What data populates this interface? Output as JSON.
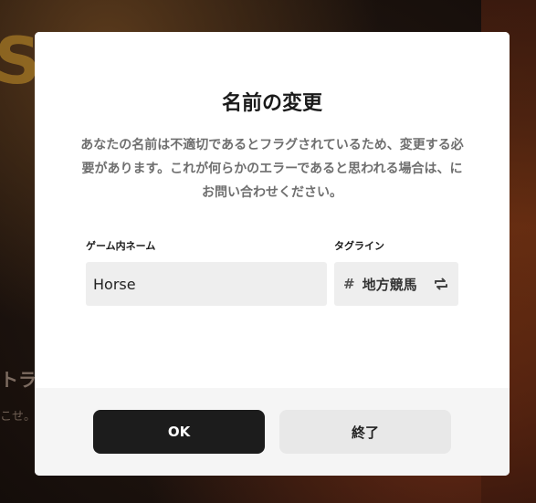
{
  "background": {
    "logo_fragment": "S",
    "text_fragment_1": "トラ",
    "text_fragment_2": "こせ。"
  },
  "dialog": {
    "title": "名前の変更",
    "message": "あなたの名前は不適切であるとフラグされているため、変更する必要があります。これが何らかのエラーであると思われる場合は、にお問い合わせください。",
    "name_field": {
      "label": "ゲーム内ネーム",
      "value": "Horse"
    },
    "tag_field": {
      "label": "タグライン",
      "prefix": "#",
      "value": "地方競馬",
      "icon": "swap-icon"
    },
    "buttons": {
      "ok_label": "OK",
      "quit_label": "終了"
    }
  },
  "colors": {
    "primary_button": "#1c1c1c",
    "secondary_button": "#e8e8e8",
    "input_background": "#eeeeee",
    "footer_background": "#f5f5f5"
  }
}
